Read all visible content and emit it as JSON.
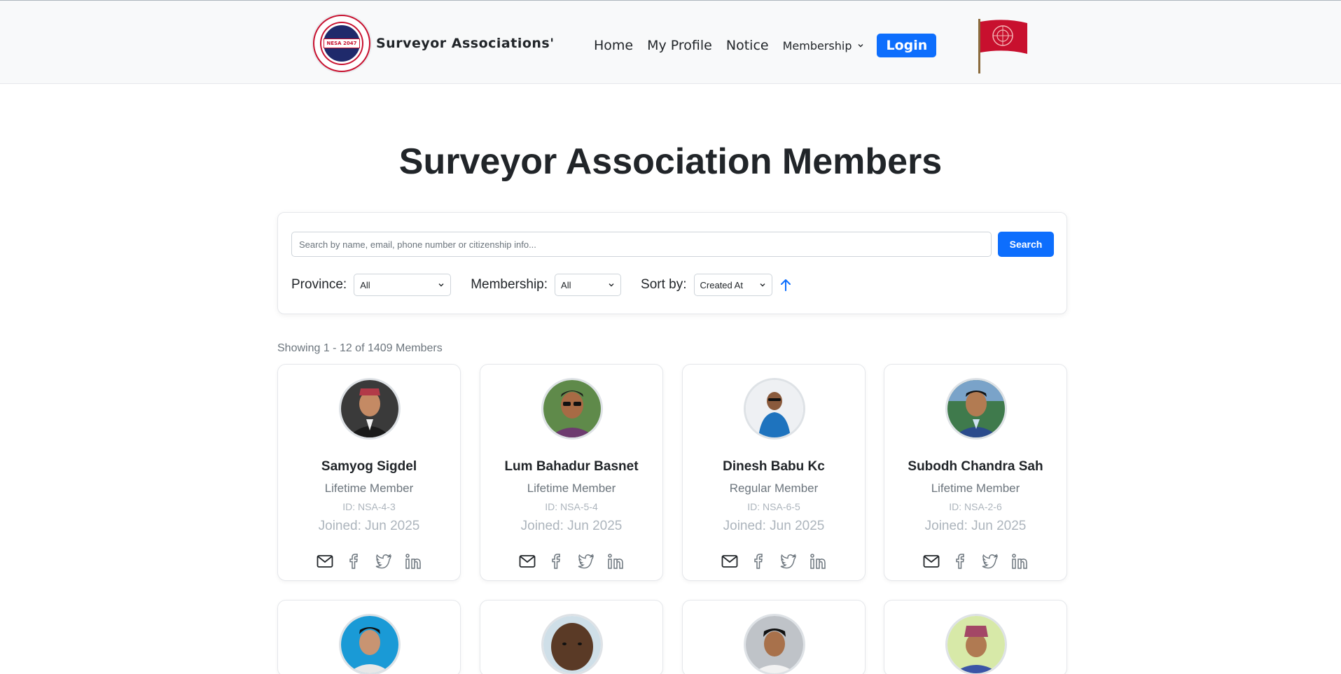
{
  "navbar": {
    "brand_name": "Surveyor Associations'",
    "logo_text": "NESA 2047",
    "links": [
      "Home",
      "My Profile",
      "Notice"
    ],
    "dropdown_label": "Membership",
    "login_label": "Login"
  },
  "page_title": "Surveyor Association Members",
  "search": {
    "placeholder": "Search by name, email, phone number or citizenship info...",
    "button_label": "Search"
  },
  "filters": {
    "province_label": "Province:",
    "province_value": "All",
    "membership_label": "Membership:",
    "membership_value": "All",
    "sort_label": "Sort by:",
    "sort_value": "Created At"
  },
  "showing_text": "Showing 1 - 12 of 1409 Members",
  "members": [
    {
      "name": "Samyog Sigdel",
      "type": "Lifetime Member",
      "id": "ID: NSA-4-3",
      "joined": "Joined: Jun 2025"
    },
    {
      "name": "Lum Bahadur Basnet",
      "type": "Lifetime Member",
      "id": "ID: NSA-5-4",
      "joined": "Joined: Jun 2025"
    },
    {
      "name": "Dinesh Babu Kc",
      "type": "Regular Member",
      "id": "ID: NSA-6-5",
      "joined": "Joined: Jun 2025"
    },
    {
      "name": "Subodh Chandra Sah",
      "type": "Lifetime Member",
      "id": "ID: NSA-2-6",
      "joined": "Joined: Jun 2025"
    }
  ],
  "colors": {
    "primary": "#0d6efd",
    "navbar_bg": "#f8f9fa",
    "flag_red": "#c8102e"
  }
}
